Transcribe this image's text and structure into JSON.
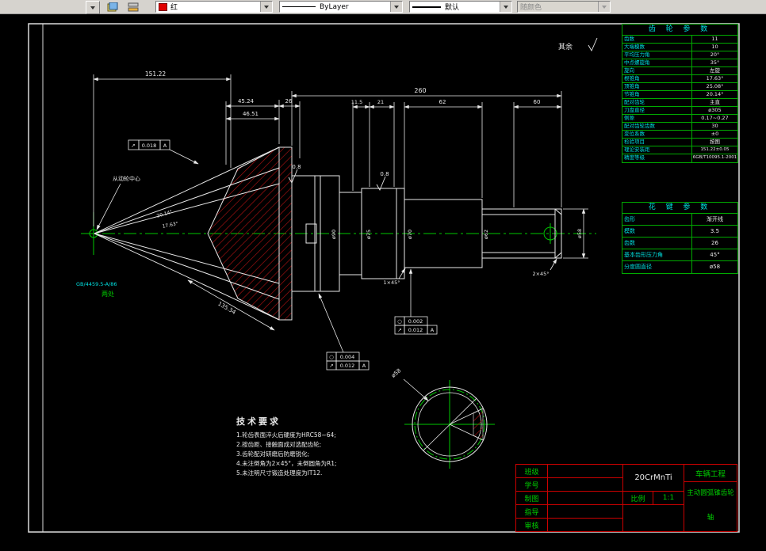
{
  "toolbar": {
    "color_label": "红",
    "color_hex": "#e00000",
    "linetype_label": "ByLayer",
    "lineweight_label": "默认",
    "plotstyle_label": "随颜色"
  },
  "frame_note": "其余",
  "notes": {
    "driven_center": "从动轮中心",
    "center_hole": "GB/4459.5-A/86",
    "two_places": "两处"
  },
  "dims": {
    "d1": "151.22",
    "d2": "45.24",
    "d3": "26",
    "d4": "46.51",
    "d5": "260",
    "d6": "11.5",
    "d7": "21",
    "d8": "62",
    "d9": "60",
    "d10": "135.34",
    "a1": "20.14°",
    "a2": "17.63°",
    "r1": "0.8",
    "r2": "0.8",
    "c1": "1×45°",
    "c2": "2×45°",
    "dia1": "ø90",
    "dia2": "ø75",
    "dia3": "ø70",
    "dia4": "ø62",
    "dia5": "ø58",
    "sec1": "ø58"
  },
  "tol": {
    "t1": {
      "sym": "↗",
      "val": "0.018",
      "datum": "A"
    },
    "t2a": {
      "sym": "○",
      "val": "0.002"
    },
    "t2b": {
      "sym": "↗",
      "val": "0.012",
      "datum": "A"
    },
    "t3a": {
      "sym": "○",
      "val": "0.004"
    },
    "t3b": {
      "sym": "↗",
      "val": "0.012",
      "datum": "A"
    }
  },
  "gear_table": {
    "title": "齿 轮 参 数",
    "rows": [
      {
        "label": "齿数",
        "value": "11"
      },
      {
        "label": "大端模数",
        "value": "10"
      },
      {
        "label": "平均压力角",
        "value": "20°"
      },
      {
        "label": "中点螺旋角",
        "value": "35°"
      },
      {
        "label": "旋向",
        "value": "左旋"
      },
      {
        "label": "根锥角",
        "value": "17.63°"
      },
      {
        "label": "顶锥角",
        "value": "25.08°"
      },
      {
        "label": "节锥角",
        "value": "20.14°"
      },
      {
        "label": "配对齿轮",
        "value": "主直"
      },
      {
        "label": "刀盘直径",
        "value": "ø305"
      },
      {
        "label": "侧隙",
        "value": "0.17~0.27"
      },
      {
        "label": "配对齿轮齿数",
        "value": "30"
      },
      {
        "label": "变位系数",
        "value": "±0"
      },
      {
        "label": "检验项目",
        "value": "按图"
      },
      {
        "label": "理论安装距",
        "value": "151.22±0.05"
      },
      {
        "label": "精度等级",
        "value": "6GB/T10095.1-2001"
      }
    ]
  },
  "spline_table": {
    "title": "花 键 参 数",
    "rows": [
      {
        "label": "齿形",
        "value": "渐开线"
      },
      {
        "label": "模数",
        "value": "3.5"
      },
      {
        "label": "齿数",
        "value": "26"
      },
      {
        "label": "基本齿形压力角",
        "value": "45°"
      },
      {
        "label": "分度圆直径",
        "value": "ø58"
      }
    ]
  },
  "tech": {
    "title": "技术要求",
    "lines": [
      "1.轮齿表面淬火后硬度为HRC58~64;",
      "2.按齿距、接触面成对选配齿轮;",
      "3.齿轮配对研磨后防磨锐化;",
      "4.未注倒角为2×45°，未倒圆角为R1;",
      "5.未注明尺寸锻造处理度为IT12."
    ]
  },
  "titleblock": {
    "labels": [
      "班级",
      "学号",
      "制图",
      "指导",
      "审核"
    ],
    "material": "20CrMnTi",
    "scale_label": "比例",
    "scale_value": "1:1",
    "dept": "车辆工程",
    "part_line1": "主动圆弧锥齿轮",
    "part_line2": "轴"
  },
  "colors": {
    "centerline_green": "#00c800",
    "hatch_red": "#aa1111",
    "titleblock_red": "#cc0000",
    "table_cyan": "#00dddd",
    "line_white": "#e8e8e8"
  }
}
